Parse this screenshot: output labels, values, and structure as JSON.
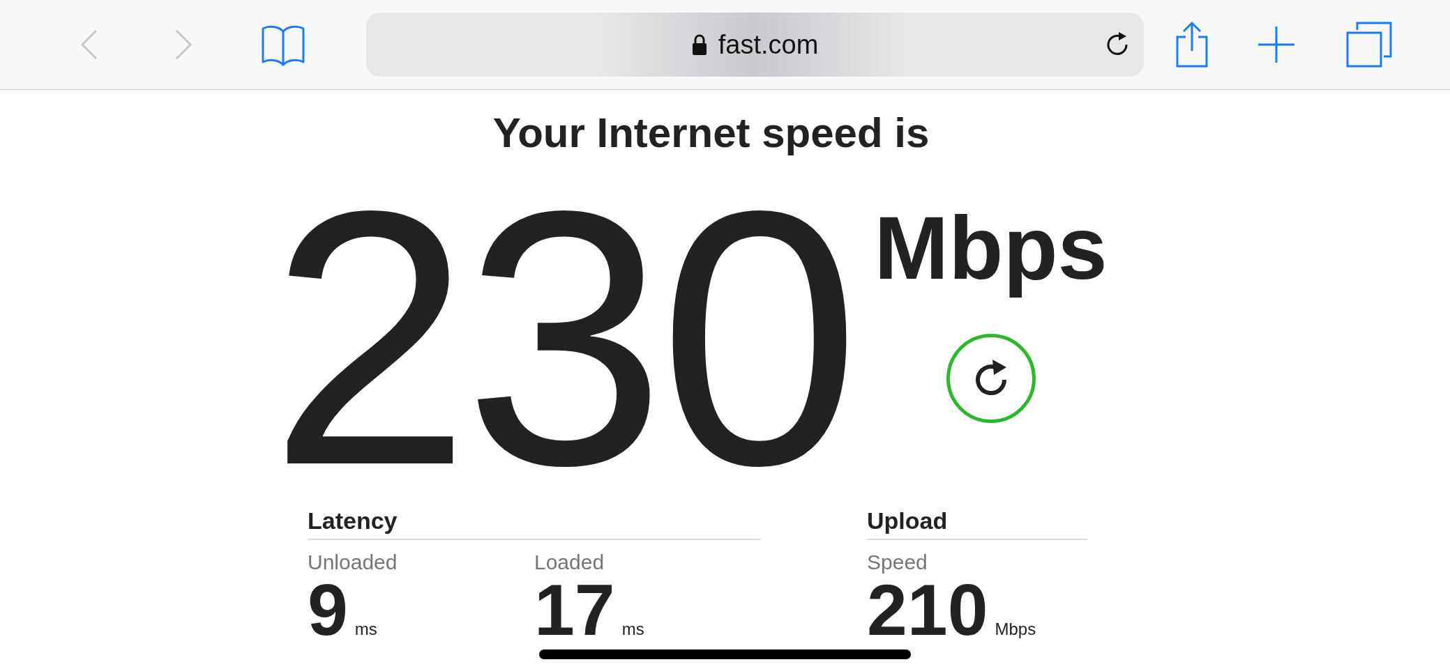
{
  "toolbar": {
    "url": "fast.com",
    "back_disabled": true,
    "forward_disabled": true
  },
  "heading": "Your Internet speed is",
  "speed": {
    "value": "230",
    "unit": "Mbps"
  },
  "groups": [
    {
      "title": "Latency",
      "stats": [
        {
          "label": "Unloaded",
          "value": "9",
          "unit": "ms"
        },
        {
          "label": "Loaded",
          "value": "17",
          "unit": "ms"
        }
      ]
    },
    {
      "title": "Upload",
      "stats": [
        {
          "label": "Speed",
          "value": "210",
          "unit": "Mbps"
        }
      ]
    }
  ]
}
